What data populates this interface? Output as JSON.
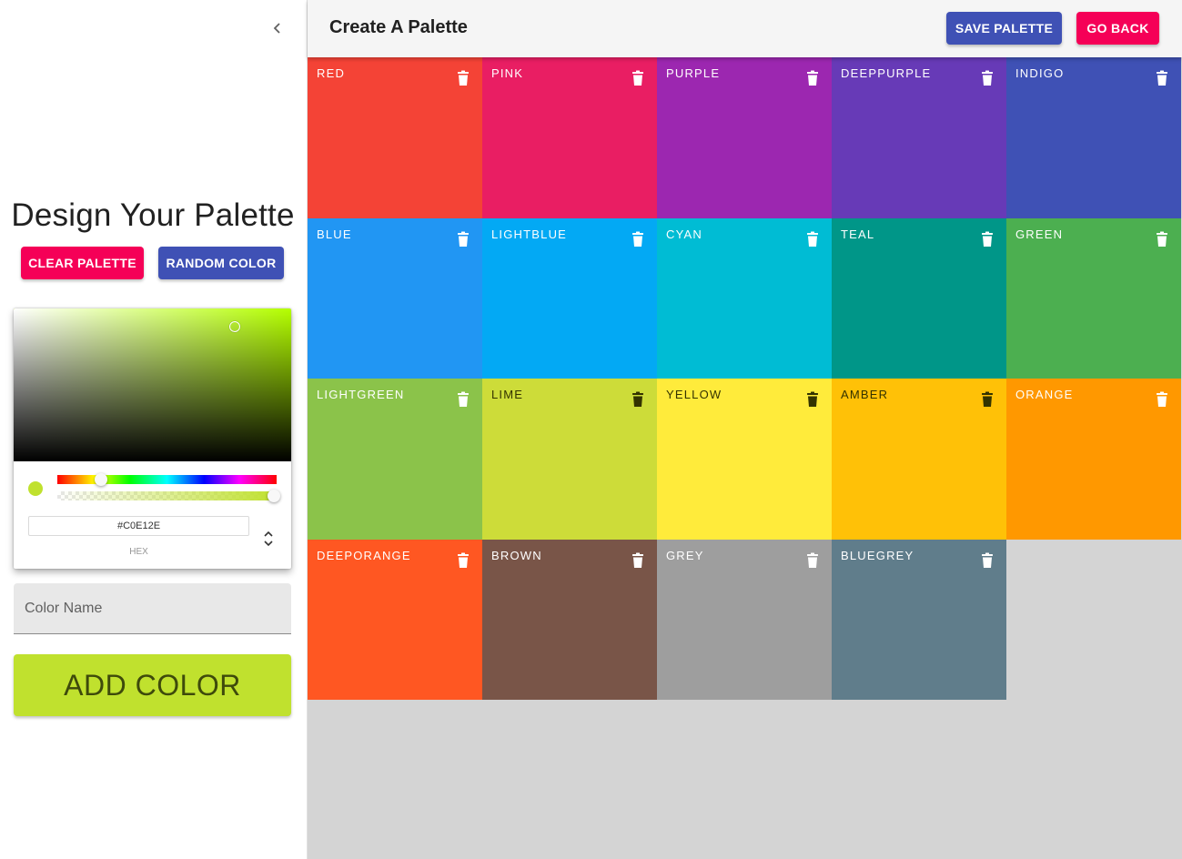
{
  "drawer": {
    "close_icon": "chevron-left-icon",
    "title": "Design Your Palette",
    "clear_label": "CLEAR PALETTE",
    "random_label": "RANDOM COLOR",
    "picker": {
      "current_color": "#C0E12E",
      "hex_value": "#C0E12E",
      "hex_label": "HEX",
      "hue_fraction": 0.2,
      "alpha_fraction": 1.0,
      "toggle_icon": "unfold-icon"
    },
    "name_placeholder": "Color Name",
    "add_label": "ADD COLOR"
  },
  "appbar": {
    "title": "Create A Palette",
    "save_label": "SAVE PALETTE",
    "back_label": "GO BACK"
  },
  "colors": [
    {
      "name": "red",
      "color": "#f44336",
      "text": "light"
    },
    {
      "name": "pink",
      "color": "#e91e63",
      "text": "light"
    },
    {
      "name": "purple",
      "color": "#9c27b0",
      "text": "light"
    },
    {
      "name": "deeppurple",
      "color": "#673ab7",
      "text": "light"
    },
    {
      "name": "indigo",
      "color": "#3f51b5",
      "text": "light"
    },
    {
      "name": "blue",
      "color": "#2196f3",
      "text": "light"
    },
    {
      "name": "lightblue",
      "color": "#03a9f4",
      "text": "light"
    },
    {
      "name": "cyan",
      "color": "#00bcd4",
      "text": "light"
    },
    {
      "name": "teal",
      "color": "#009688",
      "text": "light"
    },
    {
      "name": "green",
      "color": "#4caf50",
      "text": "light"
    },
    {
      "name": "lightgreen",
      "color": "#8bc34a",
      "text": "light"
    },
    {
      "name": "lime",
      "color": "#cddc39",
      "text": "dark"
    },
    {
      "name": "yellow",
      "color": "#ffeb3b",
      "text": "dark"
    },
    {
      "name": "amber",
      "color": "#ffc107",
      "text": "dark"
    },
    {
      "name": "orange",
      "color": "#ff9800",
      "text": "light"
    },
    {
      "name": "deeporange",
      "color": "#ff5722",
      "text": "light"
    },
    {
      "name": "brown",
      "color": "#795548",
      "text": "light"
    },
    {
      "name": "grey",
      "color": "#9e9e9e",
      "text": "light"
    },
    {
      "name": "bluegrey",
      "color": "#607d8b",
      "text": "light"
    }
  ],
  "theme": {
    "primary": "#3f51b5",
    "secondary": "#f50057",
    "light_text": "#ffffff",
    "dark_text": "#333300",
    "workspace_bg": "#d4d4d4"
  }
}
